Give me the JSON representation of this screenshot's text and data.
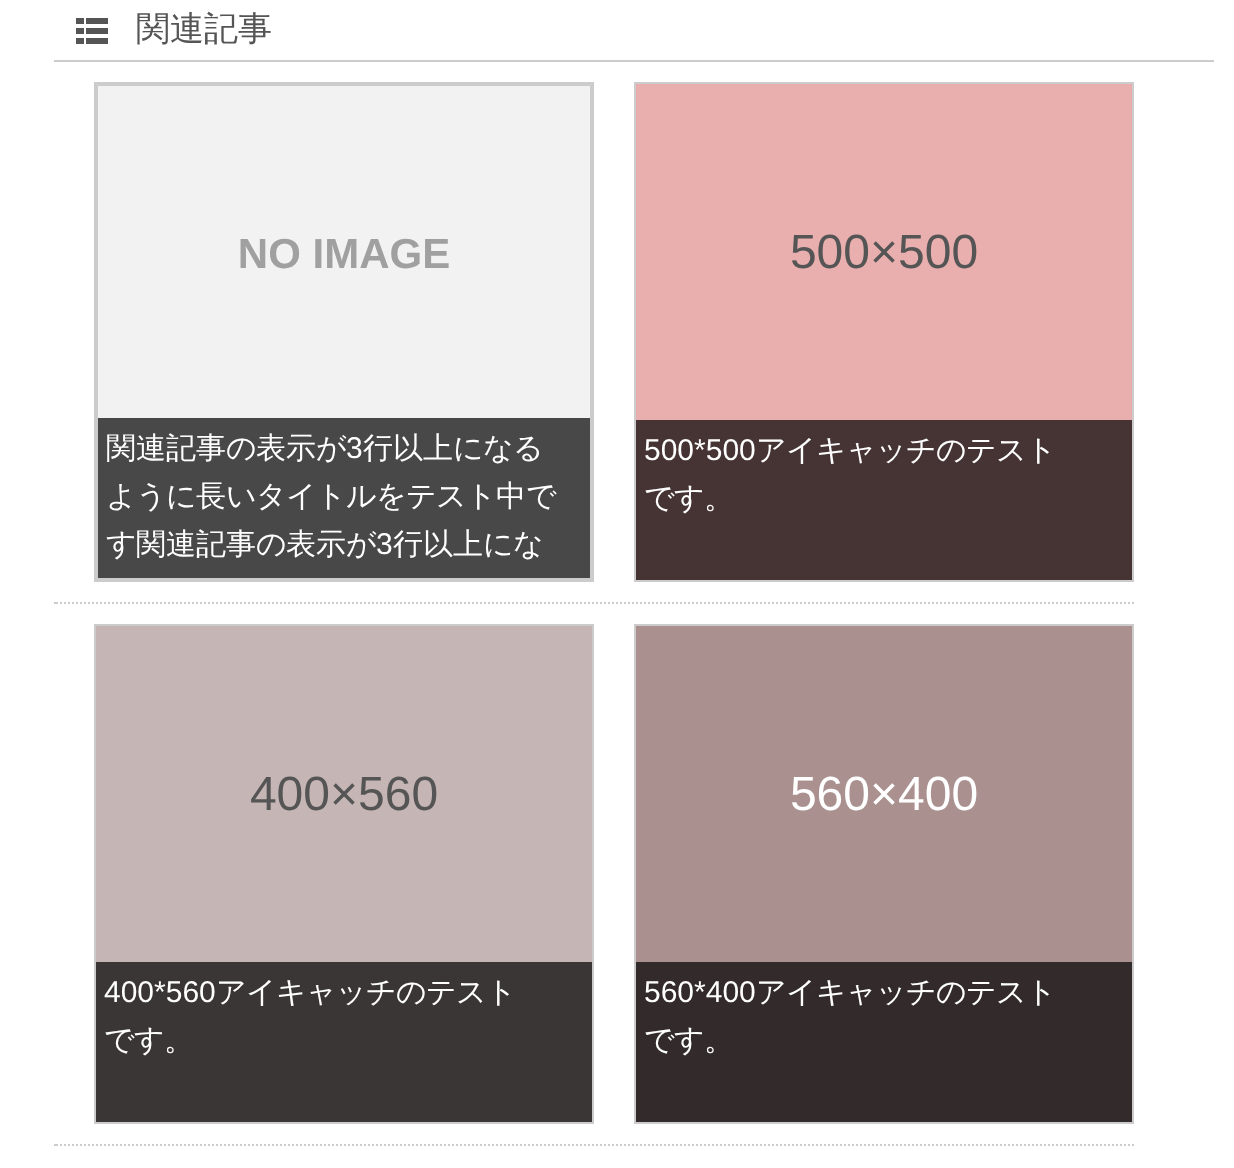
{
  "section": {
    "title": "関連記事"
  },
  "articles": [
    {
      "kind": "no-image",
      "color": "#f2f2f2",
      "image_text": "NO IMAGE",
      "caption_lines": [
        "関連記事の表示が3行以上になる",
        "ように長いタイトルをテスト中で",
        "す関連記事の表示が3行以上にな"
      ]
    },
    {
      "kind": "sized",
      "color": "#e9afaf",
      "image_text": "500×500",
      "caption_lines": [
        "500*500アイキャッチのテスト",
        "です。"
      ]
    },
    {
      "kind": "sized",
      "color": "#c6b5b5",
      "image_text": "400×560",
      "caption_lines": [
        "400*560アイキャッチのテスト",
        "です。"
      ]
    },
    {
      "kind": "sized",
      "color": "#aa9190",
      "image_text": "560×400",
      "caption_lines": [
        "560*400アイキャッチのテスト",
        "です。"
      ]
    }
  ]
}
